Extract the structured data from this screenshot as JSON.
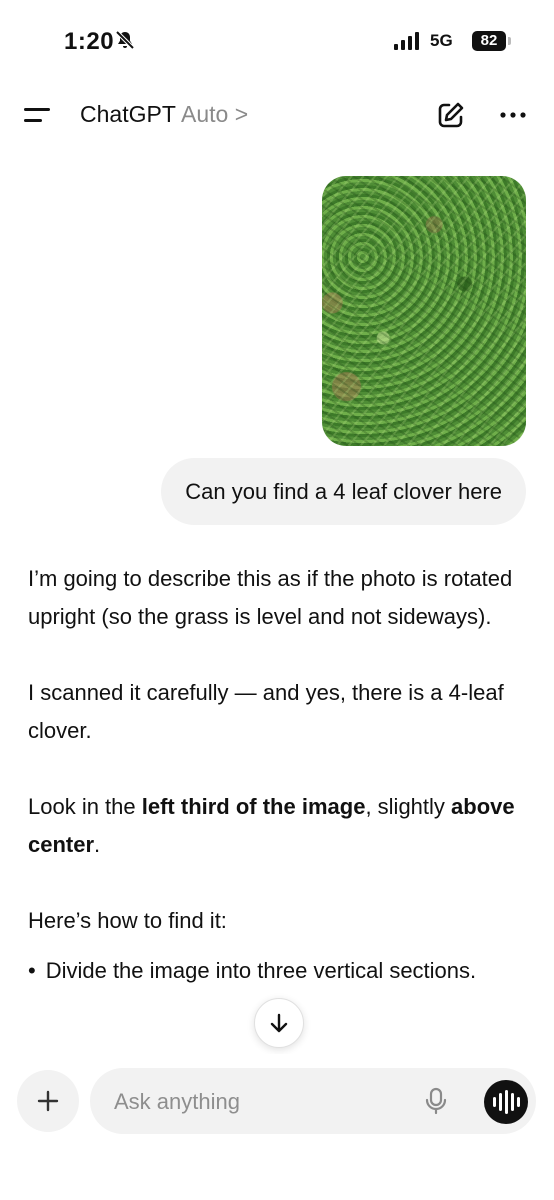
{
  "status_bar": {
    "time": "1:20",
    "network": "5G",
    "battery": "82"
  },
  "header": {
    "title": "ChatGPT",
    "model": "Auto >"
  },
  "conversation": {
    "user_message": "Can you find a 4 leaf clover here",
    "assistant_paragraphs": {
      "p1": "I’m going to describe this as if the photo is rotated upright (so the grass is level and not sideways).",
      "p2": "I scanned it carefully — and yes, there is a 4-leaf clover.",
      "p3_a": "Look in the ",
      "p3_b": "left third of the image",
      "p3_c": ", slightly ",
      "p3_d": "above center",
      "p3_e": ".",
      "p4": "Here’s how to find it:",
      "bullet_marker": "•",
      "bullet_1": "Divide the image into three vertical sections."
    }
  },
  "composer": {
    "placeholder": "Ask anything"
  },
  "icons": {
    "menu": "menu-icon",
    "edit": "new-chat-icon",
    "more": "more-dots-icon",
    "scroll": "arrow-down-icon",
    "plus": "plus-icon",
    "mic": "microphone-icon",
    "voice": "voice-mode-icon",
    "silent": "bell-slash-icon"
  }
}
